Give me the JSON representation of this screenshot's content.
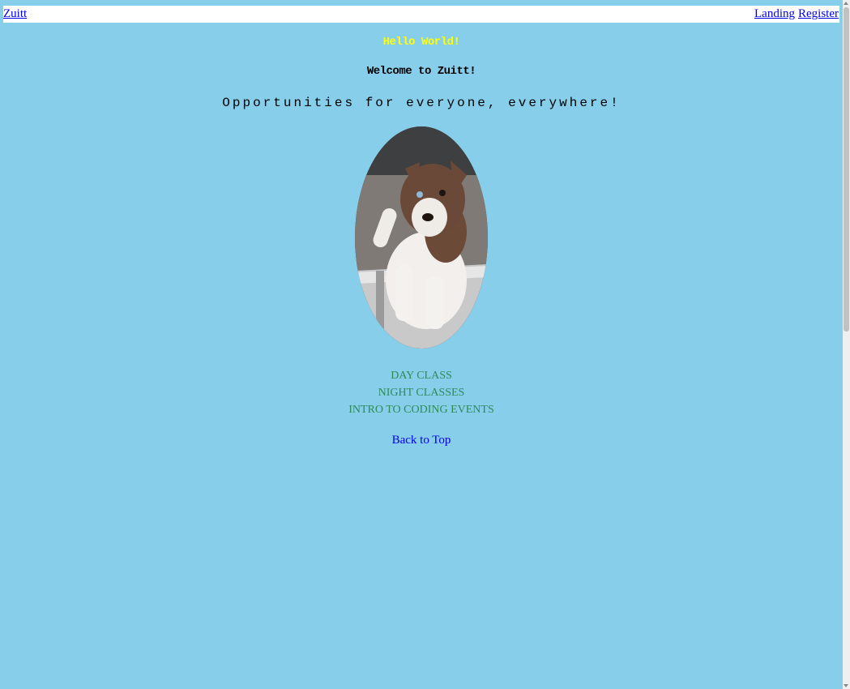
{
  "navbar": {
    "brand": "Zuitt",
    "links": [
      "Landing",
      "Register"
    ]
  },
  "header": {
    "hello": "Hello World!",
    "welcome": "Welcome to Zuitt!",
    "tagline": "Opportunities for everyone, everywhere!"
  },
  "image": {
    "icon": "dog-photo"
  },
  "classes": [
    "DAY CLASS",
    "NIGHT CLASSES",
    "INTRO TO CODING EVENTS"
  ],
  "back_to_top": "Back to Top",
  "colors": {
    "background": "#87ceeb",
    "hello_text": "#ffff00",
    "list_text": "#2e8b57",
    "link": "#0000ee"
  }
}
